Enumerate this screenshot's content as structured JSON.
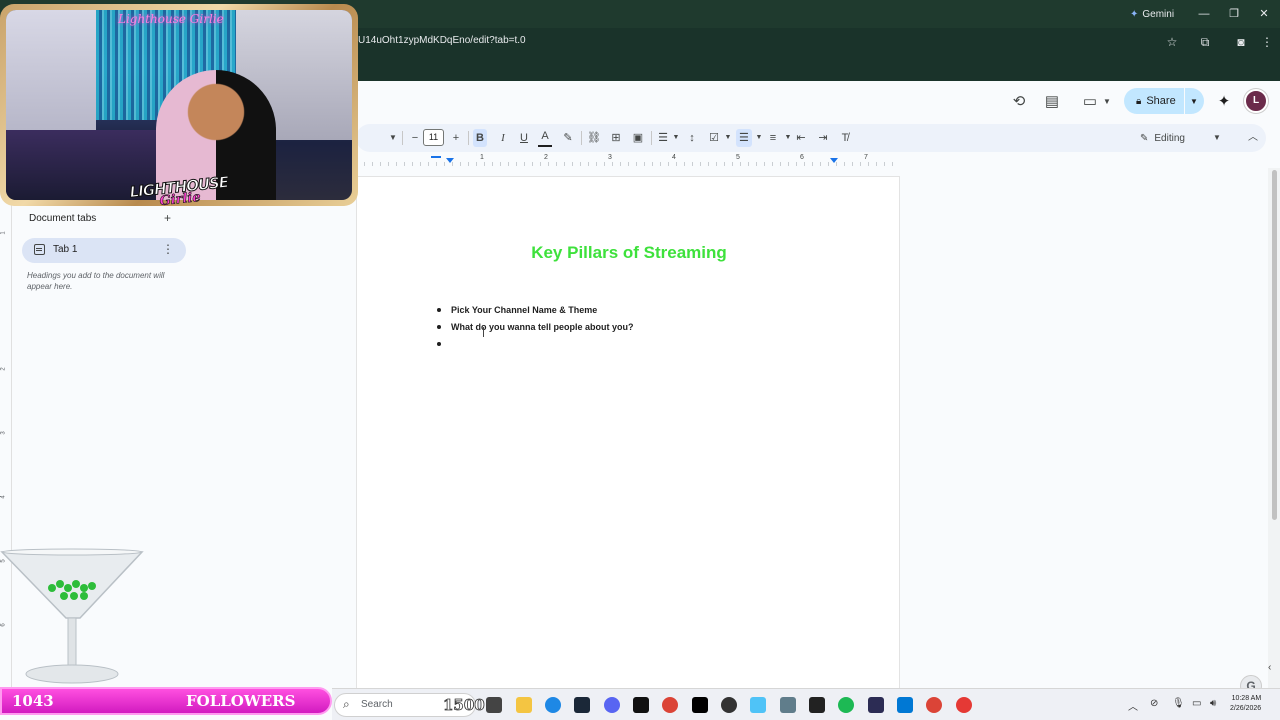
{
  "browser": {
    "url": "U14uOht1zypMdKDqEno/edit?tab=t.0",
    "gemini_label": "Gemini"
  },
  "header": {
    "share_label": "Share",
    "avatar_initial": "L"
  },
  "toolbar": {
    "font_size": "11",
    "mode_label": "Editing"
  },
  "ruler": {
    "numbers": [
      "1",
      "2",
      "3",
      "4",
      "5",
      "6",
      "7"
    ]
  },
  "sidebar": {
    "title": "Document tabs",
    "tabs": [
      {
        "label": "Tab 1"
      }
    ],
    "hint": "Headings you add to the document will appear here."
  },
  "document": {
    "title": "Key Pillars of Streaming",
    "title_color": "#3ee13c",
    "bullets": [
      "Pick Your Channel Name & Theme",
      "What do you wanna tell people about you?",
      ""
    ]
  },
  "stream_overlay": {
    "neon_sign": "Lighthouse Girlie",
    "logo_top": "LIGHTHOUSE",
    "logo_bottom": "Girlie",
    "follower_count": "1043",
    "follower_label": "FOLLOWERS",
    "follower_goal": "1500",
    "accent_color": "#ff3fd0"
  },
  "taskbar": {
    "search_placeholder": "Search",
    "time": "10:28 AM",
    "date": "2/26/2026"
  }
}
